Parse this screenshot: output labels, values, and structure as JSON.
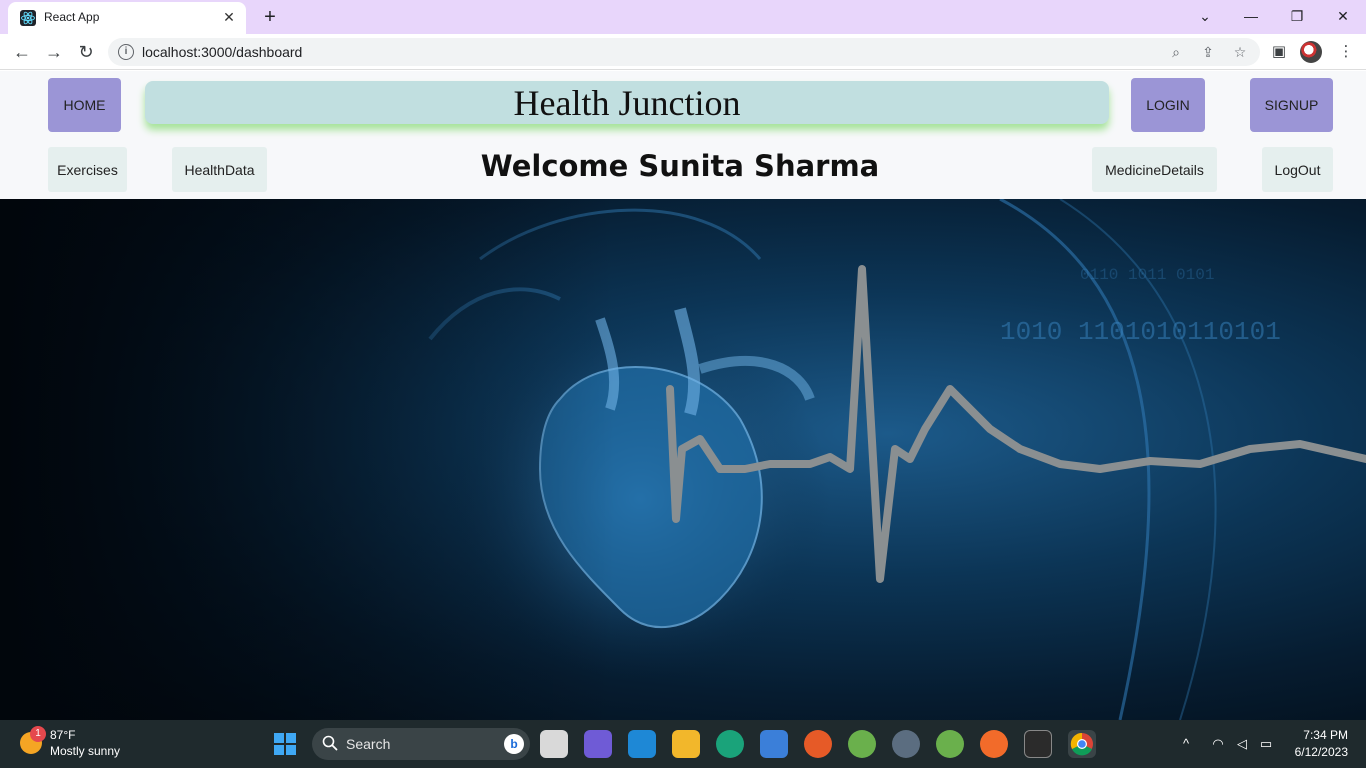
{
  "browser": {
    "tab_title": "React App",
    "tab_close": "✕",
    "new_tab": "+",
    "url": "localhost:3000/dashboard",
    "window_controls": [
      "⌄",
      "—",
      "❐",
      "✕"
    ]
  },
  "app": {
    "brand_title": "Health Junction",
    "nav": {
      "home": "HOME",
      "login": "LOGIN",
      "signup": "SIGNUP"
    },
    "welcome": "Welcome Sunita Sharma",
    "subnav": {
      "exercises": "Exercises",
      "health_data": "HealthData",
      "medicine_details": "MedicineDetails",
      "logout": "LogOut"
    },
    "hero_image": "heart-ecg-banner"
  },
  "taskbar": {
    "weather": {
      "temp": "87°F",
      "description": "Mostly sunny",
      "badge": "1"
    },
    "search_label": "Search",
    "clock": {
      "time": "7:34 PM",
      "date": "6/12/2023"
    }
  }
}
